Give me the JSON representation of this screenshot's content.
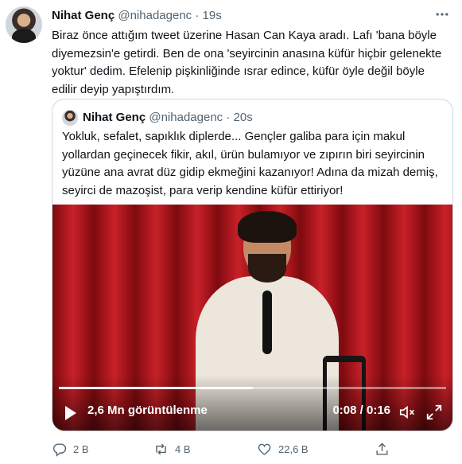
{
  "tweet": {
    "author_name": "Nihat Genç",
    "handle": "@nihadagenc",
    "separator": "·",
    "time": "19s",
    "text": "Biraz önce attığım tweet üzerine Hasan Can Kaya aradı. Lafı 'bana böyle diyemezsin'e getirdi. Ben de ona 'seyircinin anasına küfür hiçbir gelenekte yoktur' dedim. Efelenip pişkinliğinde ısrar edince, küfür öyle değil böyle edilir deyip yapıştırdım.",
    "more_icon": "more-horizontal-icon"
  },
  "quote": {
    "author_name": "Nihat Genç",
    "handle": "@nihadagenc",
    "separator": "·",
    "time": "20s",
    "text": "Yokluk, sefalet, sapıklık diplerde... Gençler galiba para için makul yollardan geçinecek fikir, akıl, ürün bulamıyor ve zıpırın biri seyircinin yüzüne ana avrat düz gidip ekmeğini kazanıyor! Adına da mizah demiş, seyirci de mazoşist, para verip kendine küfür ettiriyor!"
  },
  "video": {
    "views": "2,6 Mn görüntülenme",
    "time": "0:08 / 0:16",
    "progress": 0.5
  },
  "actions": {
    "replies": "2 B",
    "retweets": "4 B",
    "likes": "22,6 B"
  },
  "colors": {
    "text": "#0f1419",
    "muted": "#536471",
    "border": "#cfd9de",
    "curtain": "#a8161c"
  }
}
